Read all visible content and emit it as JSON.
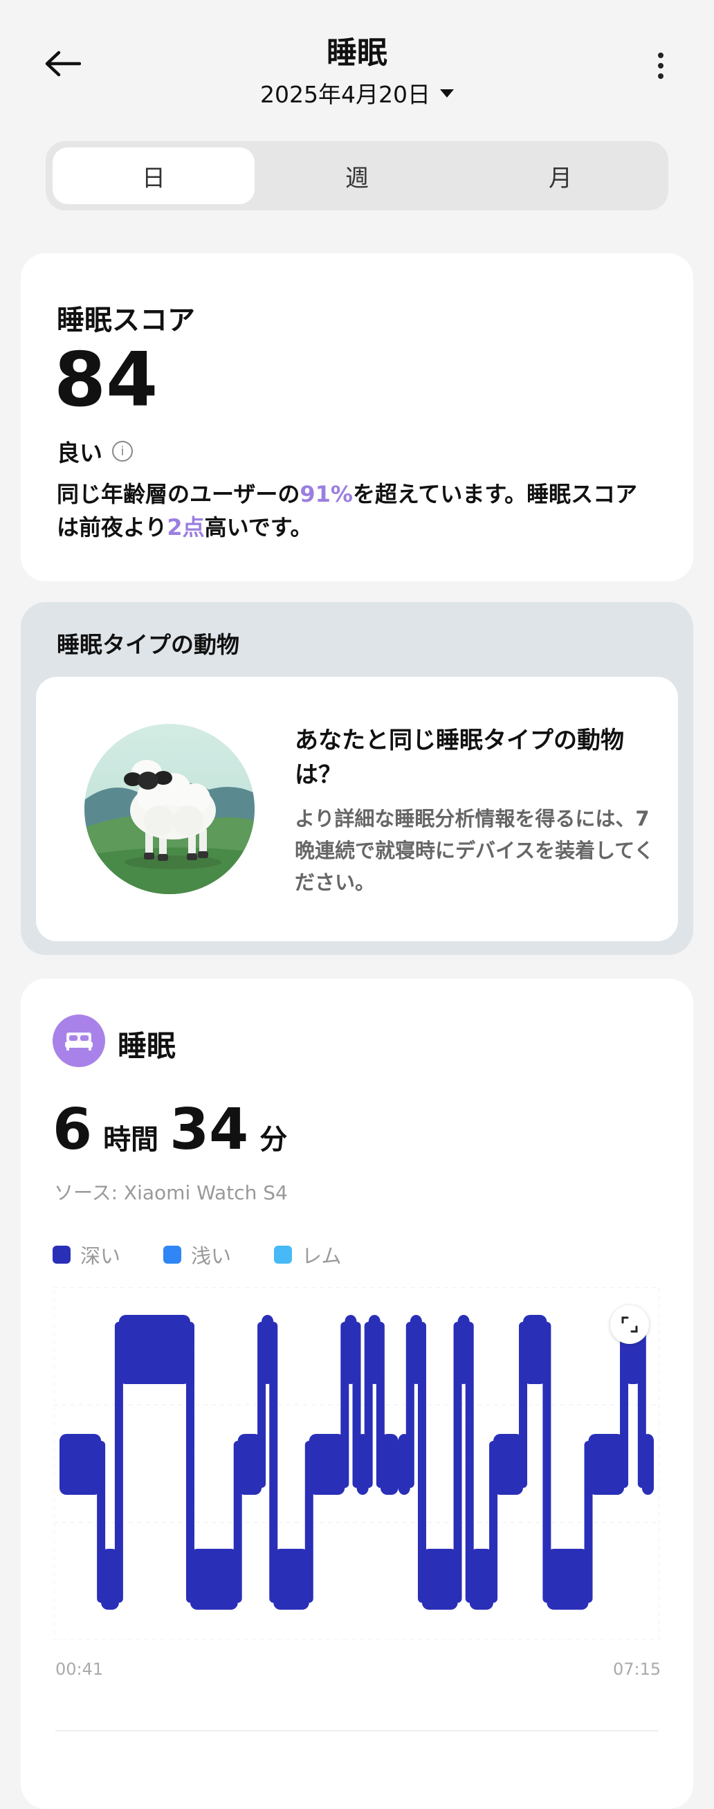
{
  "header": {
    "title": "睡眠",
    "date": "2025年4月20日"
  },
  "tabs": [
    {
      "label": "日",
      "active": true
    },
    {
      "label": "週",
      "active": false
    },
    {
      "label": "月",
      "active": false
    }
  ],
  "score": {
    "label": "睡眠スコア",
    "value": "84",
    "quality": "良い",
    "desc_part1": "同じ年齢層のユーザーの",
    "percent": "91%",
    "desc_part2": "を超えています。睡眠スコアは前夜より",
    "points": "2点",
    "desc_part3": "高いです。"
  },
  "animal": {
    "title": "睡眠タイプの動物",
    "question": "あなたと同じ睡眠タイプの動物は？",
    "subtext": "より詳細な睡眠分析情報を得るには、7晩連続で就寝時にデバイスを装着してください。",
    "image_icon": "sheep-illustration"
  },
  "sleep": {
    "title": "睡眠",
    "hours": "6",
    "hours_unit": "時間",
    "minutes": "34",
    "minutes_unit": "分",
    "source": "ソース: Xiaomi Watch S4",
    "legend": [
      {
        "label": "深い",
        "color": "#2a2fb8"
      },
      {
        "label": "浅い",
        "color": "#2f86f4"
      },
      {
        "label": "レム",
        "color": "#47b9f6"
      }
    ],
    "time_start": "00:41",
    "time_end": "07:15"
  },
  "chart_data": {
    "type": "area",
    "x_range": [
      "00:41",
      "07:15"
    ],
    "stages": [
      "レム",
      "浅い",
      "深い"
    ],
    "segments": [
      {
        "stage": "浅い",
        "start": 0.0,
        "end": 0.07
      },
      {
        "stage": "深い",
        "start": 0.07,
        "end": 0.1
      },
      {
        "stage": "レム",
        "start": 0.1,
        "end": 0.22
      },
      {
        "stage": "深い",
        "start": 0.22,
        "end": 0.3
      },
      {
        "stage": "浅い",
        "start": 0.3,
        "end": 0.34
      },
      {
        "stage": "レム",
        "start": 0.34,
        "end": 0.36
      },
      {
        "stage": "深い",
        "start": 0.36,
        "end": 0.42
      },
      {
        "stage": "浅い",
        "start": 0.42,
        "end": 0.48
      },
      {
        "stage": "レム",
        "start": 0.48,
        "end": 0.5
      },
      {
        "stage": "浅い",
        "start": 0.5,
        "end": 0.52
      },
      {
        "stage": "レム",
        "start": 0.52,
        "end": 0.54
      },
      {
        "stage": "浅い",
        "start": 0.54,
        "end": 0.57
      },
      {
        "stage": "浅い",
        "start": 0.57,
        "end": 0.59
      },
      {
        "stage": "レム",
        "start": 0.59,
        "end": 0.61
      },
      {
        "stage": "深い",
        "start": 0.61,
        "end": 0.67
      },
      {
        "stage": "レム",
        "start": 0.67,
        "end": 0.69
      },
      {
        "stage": "深い",
        "start": 0.69,
        "end": 0.73
      },
      {
        "stage": "浅い",
        "start": 0.73,
        "end": 0.78
      },
      {
        "stage": "レム",
        "start": 0.78,
        "end": 0.82
      },
      {
        "stage": "深い",
        "start": 0.82,
        "end": 0.89
      },
      {
        "stage": "浅い",
        "start": 0.89,
        "end": 0.95
      },
      {
        "stage": "レム",
        "start": 0.95,
        "end": 0.98
      },
      {
        "stage": "浅い",
        "start": 0.98,
        "end": 1.0
      }
    ]
  }
}
